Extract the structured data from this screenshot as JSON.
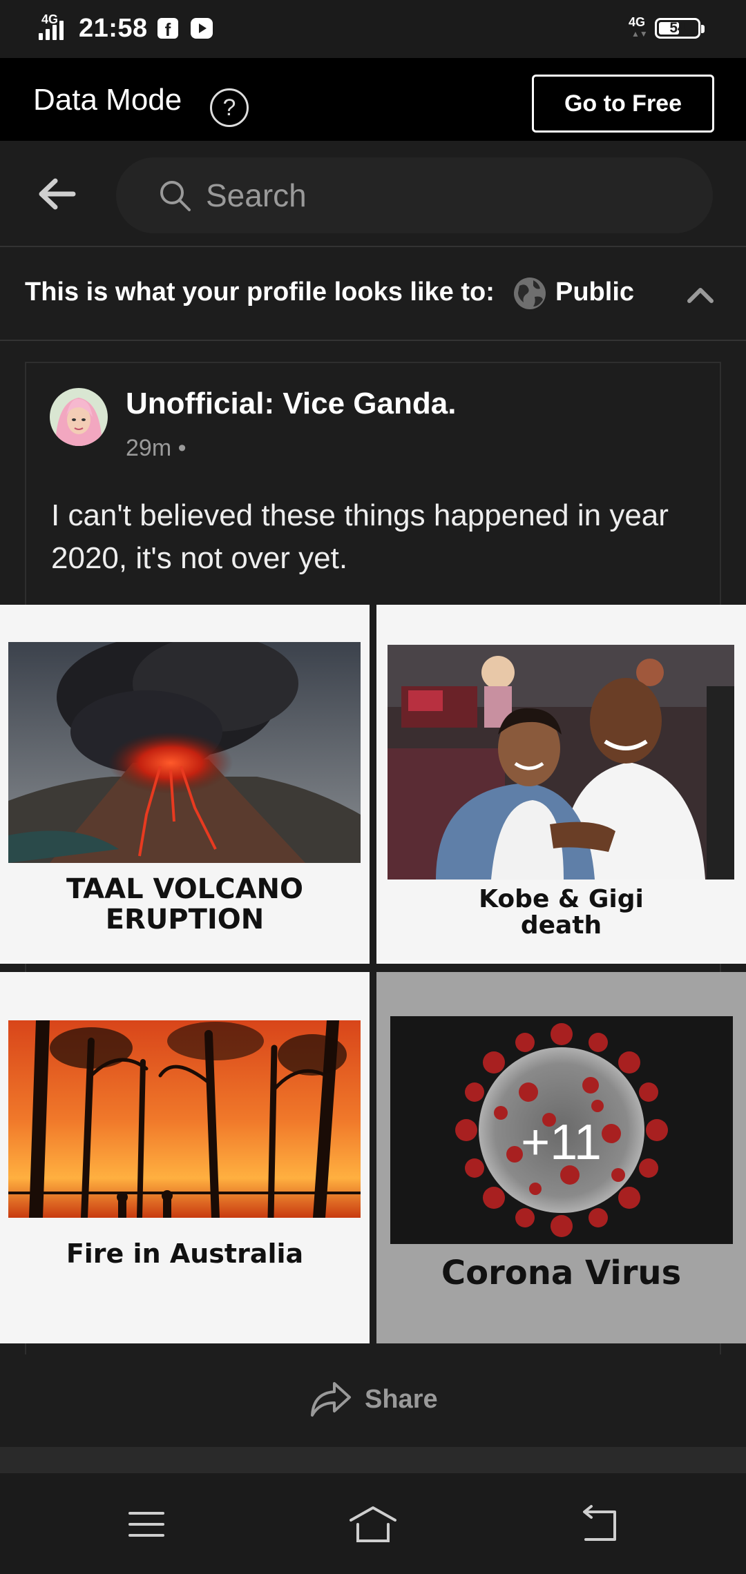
{
  "status_bar": {
    "network_label": "4G",
    "time": "21:58",
    "mobile_label": "4G",
    "battery": "54",
    "battery_level": 0.54
  },
  "data_mode": {
    "title": "Data Mode",
    "help_symbol": "?",
    "go_free_label": "Go to Free"
  },
  "search": {
    "placeholder": "Search",
    "value": ""
  },
  "privacy": {
    "text": "This is what your profile looks like to:",
    "value": "Public"
  },
  "post": {
    "author": "Unofficial: Vice Ganda.",
    "time": "29m •",
    "text": "I can't believed these things happened in year 2020, it's not over yet.",
    "images": [
      {
        "caption_line1": "TAAL VOLCANO",
        "caption_line2": "ERUPTION"
      },
      {
        "caption_line1": "Kobe & Gigi",
        "caption_line2": "death"
      },
      {
        "caption_line1": "Fire in Australia"
      },
      {
        "caption_line1": "Corona Virus",
        "more_count": "+11"
      }
    ]
  },
  "actions": {
    "share_label": "Share"
  },
  "colors": {
    "background": "#1d1d1d",
    "status_bar": "#1b1b1b",
    "secondary_text": "#9a9a9a"
  },
  "icons": [
    "facebook-icon",
    "youtube-icon",
    "help-icon",
    "back-arrow-icon",
    "search-icon",
    "globe-icon",
    "chevron-up-icon",
    "share-icon",
    "menu-icon",
    "home-icon",
    "back-icon"
  ]
}
